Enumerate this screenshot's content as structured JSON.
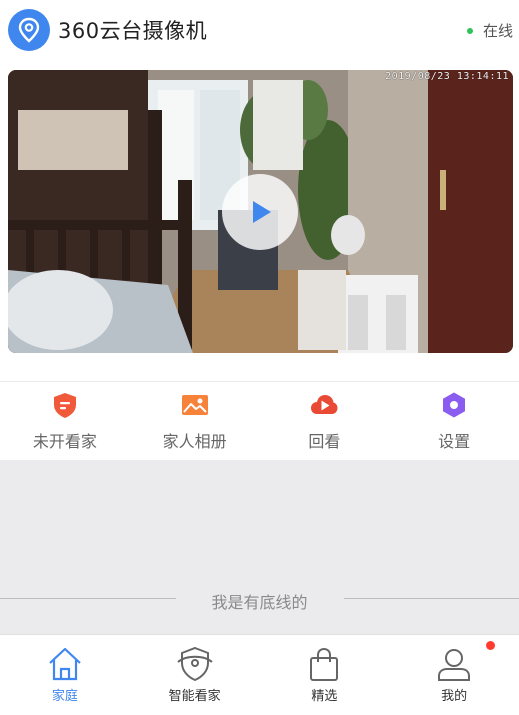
{
  "header": {
    "app_title": "360云台摄像机",
    "logo_icon": "location-pin-icon",
    "status_label": "在线",
    "status_color": "#2fc25b"
  },
  "camera": {
    "timestamp": "2019/08/23 13:14:11",
    "play_icon": "play-icon"
  },
  "features": [
    {
      "label": "未开看家",
      "icon": "shield-icon",
      "color": "#f05a3a"
    },
    {
      "label": "家人相册",
      "icon": "photo-album-icon",
      "color": "#f7823a"
    },
    {
      "label": "回看",
      "icon": "cloud-playback-icon",
      "color": "#e84a36"
    },
    {
      "label": "设置",
      "icon": "hexagon-settings-icon",
      "color": "#8a5cf0"
    }
  ],
  "bottom_text": "我是有底线的",
  "tabbar": [
    {
      "label": "家庭",
      "icon": "home-icon",
      "active": true
    },
    {
      "label": "智能看家",
      "icon": "shield-eye-icon",
      "active": false
    },
    {
      "label": "精选",
      "icon": "shopping-bag-icon",
      "active": false
    },
    {
      "label": "我的",
      "icon": "user-icon",
      "active": false,
      "badge": true
    }
  ],
  "colors": {
    "accent": "#3f86ee",
    "badge": "#ff3b30"
  }
}
